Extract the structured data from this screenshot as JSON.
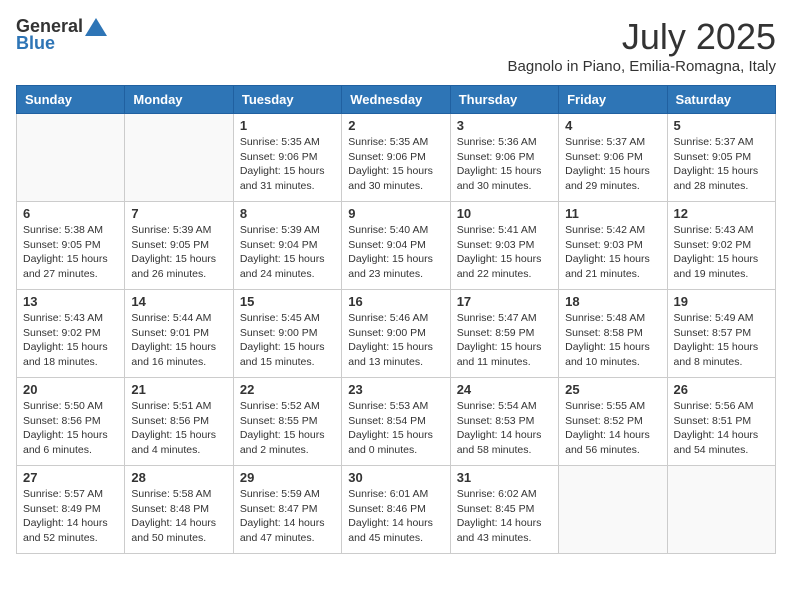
{
  "logo": {
    "general": "General",
    "blue": "Blue"
  },
  "title": {
    "month": "July 2025",
    "location": "Bagnolo in Piano, Emilia-Romagna, Italy"
  },
  "headers": [
    "Sunday",
    "Monday",
    "Tuesday",
    "Wednesday",
    "Thursday",
    "Friday",
    "Saturday"
  ],
  "weeks": [
    [
      {
        "day": "",
        "info": ""
      },
      {
        "day": "",
        "info": ""
      },
      {
        "day": "1",
        "info": "Sunrise: 5:35 AM\nSunset: 9:06 PM\nDaylight: 15 hours and 31 minutes."
      },
      {
        "day": "2",
        "info": "Sunrise: 5:35 AM\nSunset: 9:06 PM\nDaylight: 15 hours and 30 minutes."
      },
      {
        "day": "3",
        "info": "Sunrise: 5:36 AM\nSunset: 9:06 PM\nDaylight: 15 hours and 30 minutes."
      },
      {
        "day": "4",
        "info": "Sunrise: 5:37 AM\nSunset: 9:06 PM\nDaylight: 15 hours and 29 minutes."
      },
      {
        "day": "5",
        "info": "Sunrise: 5:37 AM\nSunset: 9:05 PM\nDaylight: 15 hours and 28 minutes."
      }
    ],
    [
      {
        "day": "6",
        "info": "Sunrise: 5:38 AM\nSunset: 9:05 PM\nDaylight: 15 hours and 27 minutes."
      },
      {
        "day": "7",
        "info": "Sunrise: 5:39 AM\nSunset: 9:05 PM\nDaylight: 15 hours and 26 minutes."
      },
      {
        "day": "8",
        "info": "Sunrise: 5:39 AM\nSunset: 9:04 PM\nDaylight: 15 hours and 24 minutes."
      },
      {
        "day": "9",
        "info": "Sunrise: 5:40 AM\nSunset: 9:04 PM\nDaylight: 15 hours and 23 minutes."
      },
      {
        "day": "10",
        "info": "Sunrise: 5:41 AM\nSunset: 9:03 PM\nDaylight: 15 hours and 22 minutes."
      },
      {
        "day": "11",
        "info": "Sunrise: 5:42 AM\nSunset: 9:03 PM\nDaylight: 15 hours and 21 minutes."
      },
      {
        "day": "12",
        "info": "Sunrise: 5:43 AM\nSunset: 9:02 PM\nDaylight: 15 hours and 19 minutes."
      }
    ],
    [
      {
        "day": "13",
        "info": "Sunrise: 5:43 AM\nSunset: 9:02 PM\nDaylight: 15 hours and 18 minutes."
      },
      {
        "day": "14",
        "info": "Sunrise: 5:44 AM\nSunset: 9:01 PM\nDaylight: 15 hours and 16 minutes."
      },
      {
        "day": "15",
        "info": "Sunrise: 5:45 AM\nSunset: 9:00 PM\nDaylight: 15 hours and 15 minutes."
      },
      {
        "day": "16",
        "info": "Sunrise: 5:46 AM\nSunset: 9:00 PM\nDaylight: 15 hours and 13 minutes."
      },
      {
        "day": "17",
        "info": "Sunrise: 5:47 AM\nSunset: 8:59 PM\nDaylight: 15 hours and 11 minutes."
      },
      {
        "day": "18",
        "info": "Sunrise: 5:48 AM\nSunset: 8:58 PM\nDaylight: 15 hours and 10 minutes."
      },
      {
        "day": "19",
        "info": "Sunrise: 5:49 AM\nSunset: 8:57 PM\nDaylight: 15 hours and 8 minutes."
      }
    ],
    [
      {
        "day": "20",
        "info": "Sunrise: 5:50 AM\nSunset: 8:56 PM\nDaylight: 15 hours and 6 minutes."
      },
      {
        "day": "21",
        "info": "Sunrise: 5:51 AM\nSunset: 8:56 PM\nDaylight: 15 hours and 4 minutes."
      },
      {
        "day": "22",
        "info": "Sunrise: 5:52 AM\nSunset: 8:55 PM\nDaylight: 15 hours and 2 minutes."
      },
      {
        "day": "23",
        "info": "Sunrise: 5:53 AM\nSunset: 8:54 PM\nDaylight: 15 hours and 0 minutes."
      },
      {
        "day": "24",
        "info": "Sunrise: 5:54 AM\nSunset: 8:53 PM\nDaylight: 14 hours and 58 minutes."
      },
      {
        "day": "25",
        "info": "Sunrise: 5:55 AM\nSunset: 8:52 PM\nDaylight: 14 hours and 56 minutes."
      },
      {
        "day": "26",
        "info": "Sunrise: 5:56 AM\nSunset: 8:51 PM\nDaylight: 14 hours and 54 minutes."
      }
    ],
    [
      {
        "day": "27",
        "info": "Sunrise: 5:57 AM\nSunset: 8:49 PM\nDaylight: 14 hours and 52 minutes."
      },
      {
        "day": "28",
        "info": "Sunrise: 5:58 AM\nSunset: 8:48 PM\nDaylight: 14 hours and 50 minutes."
      },
      {
        "day": "29",
        "info": "Sunrise: 5:59 AM\nSunset: 8:47 PM\nDaylight: 14 hours and 47 minutes."
      },
      {
        "day": "30",
        "info": "Sunrise: 6:01 AM\nSunset: 8:46 PM\nDaylight: 14 hours and 45 minutes."
      },
      {
        "day": "31",
        "info": "Sunrise: 6:02 AM\nSunset: 8:45 PM\nDaylight: 14 hours and 43 minutes."
      },
      {
        "day": "",
        "info": ""
      },
      {
        "day": "",
        "info": ""
      }
    ]
  ]
}
